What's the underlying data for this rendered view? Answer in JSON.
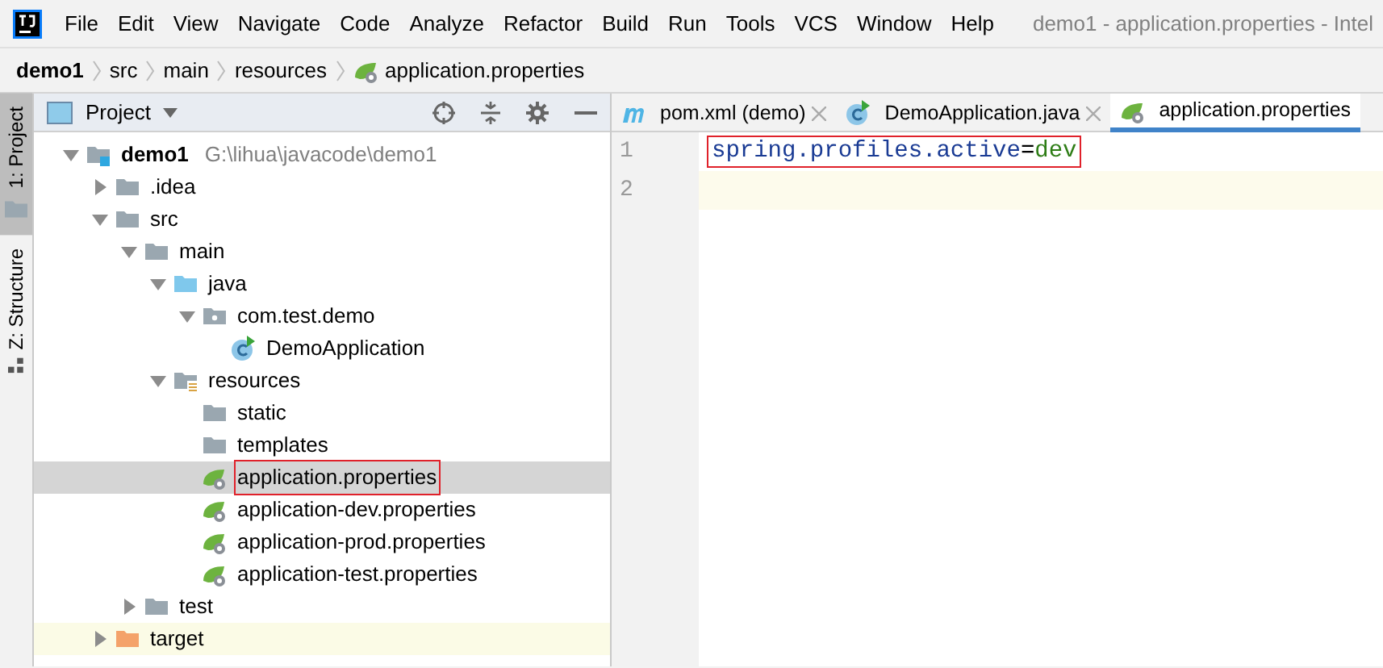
{
  "window": {
    "title": "demo1 - application.properties - Intel"
  },
  "menu": [
    "File",
    "Edit",
    "View",
    "Navigate",
    "Code",
    "Analyze",
    "Refactor",
    "Build",
    "Run",
    "Tools",
    "VCS",
    "Window",
    "Help"
  ],
  "breadcrumb": [
    {
      "label": "demo1",
      "kind": "module"
    },
    {
      "label": "src",
      "kind": "folder"
    },
    {
      "label": "main",
      "kind": "folder"
    },
    {
      "label": "resources",
      "kind": "folder"
    },
    {
      "label": "application.properties",
      "kind": "properties"
    }
  ],
  "tool_strip": [
    {
      "label": "1: Project",
      "kind": "folder",
      "selected": true
    },
    {
      "label": "Z: Structure",
      "kind": "structure",
      "selected": false
    }
  ],
  "project_panel": {
    "title": "Project"
  },
  "tree": [
    {
      "label": "demo1",
      "path": "G:\\lihua\\javacode\\demo1",
      "kind": "module",
      "expanded": true,
      "selected": false,
      "highlighted": false,
      "children": [
        {
          "label": ".idea",
          "kind": "folder",
          "expanded": false,
          "selected": false,
          "highlighted": false
        },
        {
          "label": "src",
          "kind": "folder",
          "expanded": true,
          "selected": false,
          "highlighted": false,
          "children": [
            {
              "label": "main",
              "kind": "folder",
              "expanded": true,
              "selected": false,
              "highlighted": false,
              "children": [
                {
                  "label": "java",
                  "kind": "source-folder",
                  "expanded": true,
                  "selected": false,
                  "highlighted": false,
                  "children": [
                    {
                      "label": "com.test.demo",
                      "kind": "package",
                      "expanded": true,
                      "selected": false,
                      "highlighted": false,
                      "children": [
                        {
                          "label": "DemoApplication",
                          "kind": "class",
                          "selected": false,
                          "highlighted": false
                        }
                      ]
                    }
                  ]
                },
                {
                  "label": "resources",
                  "kind": "resources-folder",
                  "expanded": true,
                  "selected": false,
                  "highlighted": false,
                  "children": [
                    {
                      "label": "static",
                      "kind": "folder",
                      "selected": false,
                      "highlighted": false
                    },
                    {
                      "label": "templates",
                      "kind": "folder",
                      "selected": false,
                      "highlighted": false
                    },
                    {
                      "label": "application.properties",
                      "kind": "properties",
                      "selected": true,
                      "highlighted": true
                    },
                    {
                      "label": "application-dev.properties",
                      "kind": "properties",
                      "selected": false,
                      "highlighted": false
                    },
                    {
                      "label": "application-prod.properties",
                      "kind": "properties",
                      "selected": false,
                      "highlighted": false
                    },
                    {
                      "label": "application-test.properties",
                      "kind": "properties",
                      "selected": false,
                      "highlighted": false
                    }
                  ]
                }
              ]
            },
            {
              "label": "test",
              "kind": "folder",
              "expanded": false,
              "selected": false,
              "highlighted": false
            }
          ]
        },
        {
          "label": "target",
          "kind": "excluded-folder",
          "expanded": false,
          "selected": false,
          "highlighted": false
        }
      ]
    }
  ],
  "editor_tabs": [
    {
      "label": "pom.xml (demo)",
      "kind": "maven",
      "selected": false,
      "closable": true
    },
    {
      "label": "DemoApplication.java",
      "kind": "class",
      "selected": false,
      "closable": true
    },
    {
      "label": "application.properties",
      "kind": "properties",
      "selected": true,
      "closable": false
    }
  ],
  "editor_lines": [
    {
      "number": "1",
      "current": false,
      "highlighted": true,
      "tokens": [
        {
          "kind": "key",
          "text": "spring.profiles.active"
        },
        {
          "kind": "separator",
          "text": "="
        },
        {
          "kind": "value",
          "text": "dev"
        }
      ]
    },
    {
      "number": "2",
      "current": true,
      "highlighted": false
    }
  ]
}
